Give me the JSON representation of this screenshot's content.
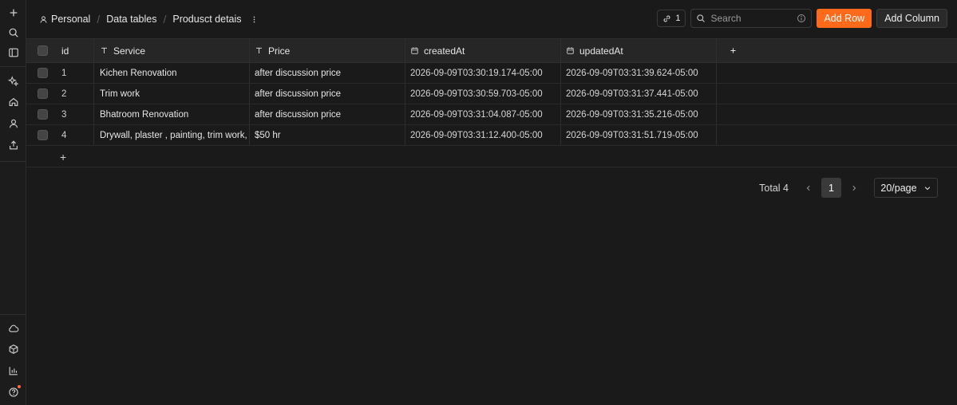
{
  "rail": {
    "top_icons": [
      "plus-icon",
      "search-icon",
      "sidebar-toggle-icon"
    ],
    "mid_icons": [
      "sparkle-icon",
      "home-icon",
      "user-icon",
      "upload-icon"
    ],
    "bottom_icons": [
      "cloud-icon",
      "package-icon",
      "chart-icon",
      "help-icon"
    ],
    "notification_color": "#ff6a3d"
  },
  "breadcrumb": {
    "items": [
      "Personal",
      "Data tables",
      "Produsct detais"
    ]
  },
  "header": {
    "link_count": "1",
    "search_placeholder": "Search",
    "add_row_label": "Add Row",
    "add_column_label": "Add Column",
    "accent": "#ff6a1a"
  },
  "table": {
    "columns": [
      {
        "label": "id",
        "icon": ""
      },
      {
        "label": "Service",
        "icon": "text-type-icon"
      },
      {
        "label": "Price",
        "icon": "text-type-icon"
      },
      {
        "label": "createdAt",
        "icon": "calendar-icon"
      },
      {
        "label": "updatedAt",
        "icon": "calendar-icon"
      }
    ],
    "rows": [
      {
        "id": "1",
        "service": "Kichen Renovation",
        "price": "after discussion price",
        "createdAt": "2026-09-09T03:30:19.174-05:00",
        "updatedAt": "2026-09-09T03:31:39.624-05:00"
      },
      {
        "id": "2",
        "service": "Trim work",
        "price": "after discussion price",
        "createdAt": "2026-09-09T03:30:59.703-05:00",
        "updatedAt": "2026-09-09T03:31:37.441-05:00"
      },
      {
        "id": "3",
        "service": "Bhatroom Renovation",
        "price": "after discussion price",
        "createdAt": "2026-09-09T03:31:04.087-05:00",
        "updatedAt": "2026-09-09T03:31:35.216-05:00"
      },
      {
        "id": "4",
        "service": "Drywall, plaster , painting, trim work, dc",
        "price": "$50 hr",
        "createdAt": "2026-09-09T03:31:12.400-05:00",
        "updatedAt": "2026-09-09T03:31:51.719-05:00"
      }
    ]
  },
  "pagination": {
    "total": "Total 4",
    "current_page": "1",
    "page_size": "20/page"
  }
}
